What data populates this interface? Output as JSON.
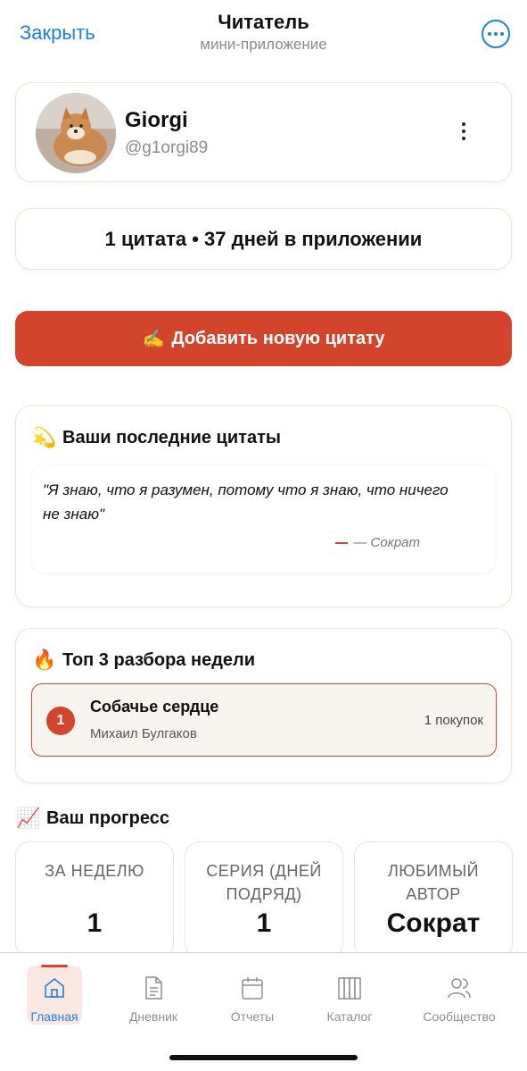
{
  "header": {
    "close_label": "Закрыть",
    "title": "Читатель",
    "subtitle": "мини-приложение",
    "more_icon": "more-horizontal-circle-icon"
  },
  "profile": {
    "name": "Giorgi",
    "handle": "@g1orgi89"
  },
  "stats": {
    "text": "1 цитата • 37 дней в приложении"
  },
  "add_button": {
    "emoji": "✍️",
    "label": "Добавить новую цитату"
  },
  "recent_quotes": {
    "emoji": "💫",
    "title": "Ваши последние цитаты",
    "items": [
      {
        "text": "\"Я знаю, что я разумен, потому что я знаю, что ничего не знаю\"",
        "author": "— Сократ"
      }
    ]
  },
  "top3": {
    "emoji": "🔥",
    "title": "Топ 3 разбора недели",
    "items": [
      {
        "rank": "1",
        "title": "Собачье сердце",
        "author": "Михаил Булгаков",
        "purchases": "1 покупок"
      }
    ]
  },
  "progress": {
    "emoji": "📈",
    "title": "Ваш прогресс",
    "cards": [
      {
        "label": "ЗА НЕДЕЛЮ",
        "value": "1"
      },
      {
        "label": "СЕРИЯ (ДНЕЙ ПОДРЯД)",
        "value": "1"
      },
      {
        "label": "ЛЮБИМЫЙ АВТОР",
        "value": "Сократ"
      }
    ]
  },
  "tabbar": {
    "items": [
      {
        "label": "Главная",
        "icon": "home-icon",
        "active": true
      },
      {
        "label": "Дневник",
        "icon": "document-icon",
        "active": false
      },
      {
        "label": "Отчеты",
        "icon": "calendar-icon",
        "active": false
      },
      {
        "label": "Каталог",
        "icon": "books-icon",
        "active": false
      },
      {
        "label": "Сообщество",
        "icon": "users-icon",
        "active": false
      }
    ]
  },
  "colors": {
    "accent": "#d2452c",
    "link_blue": "#1f7fe0"
  }
}
